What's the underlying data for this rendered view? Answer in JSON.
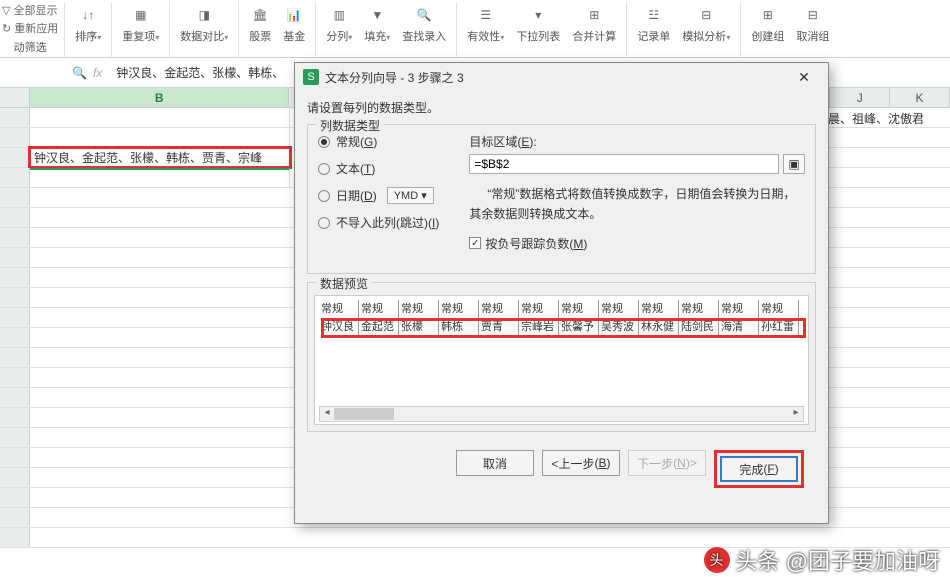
{
  "ribbon": {
    "group1": {
      "show_all": "全部显示",
      "reapply": "重新应用",
      "auto_filter": "动筛选"
    },
    "sort": "排序",
    "dedupe": "重复项",
    "compare": "数据对比",
    "stock": "股票",
    "fund": "基金",
    "split": "分列",
    "fill": "填充",
    "lookup": "查找录入",
    "validity": "有效性",
    "dropdown": "下拉列表",
    "consolidate": "合并计算",
    "record": "记录单",
    "whatif": "模拟分析",
    "group": "创建组",
    "ungroup": "取消组"
  },
  "formula_bar": {
    "text": "钟汉良、金起范、张檬、韩栋、"
  },
  "columns": {
    "B": "B",
    "J": "J",
    "K": "K"
  },
  "cell_text": "钟汉良、金起范、张檬、韩栋、贾青、宗峰",
  "right_cell_text": "晨、祖峰、沈傲君",
  "dialog": {
    "title": "文本分列向导 - 3 步骤之 3",
    "hint": "请设置每列的数据类型。",
    "col_type_legend": "列数据类型",
    "radio_general": "常规",
    "radio_text": "文本",
    "radio_date": "日期",
    "ymd": "YMD",
    "radio_skip": "不导入此列(跳过)",
    "g": "G",
    "t": "T",
    "d": "D",
    "i": "I",
    "target_label": "目标区域",
    "target_key": "E",
    "target_value": "=$B$2",
    "desc": "“常规”数据格式将数值转换成数字，日期值会转换为日期，其余数据则转换成文本。",
    "chk_neg": "按负号跟踪负数",
    "m": "M",
    "preview_legend": "数据预览",
    "preview_head": "常规",
    "preview_cells": [
      "钟汉良",
      "金起范",
      "张檬",
      "韩栋",
      "贾青",
      "宗峰岩",
      "张馨予",
      "吴秀波",
      "林永健",
      "陆剑民",
      "海清",
      "孙红雷"
    ],
    "btn_cancel": "取消",
    "btn_back": "<上一步",
    "btn_back_k": "B",
    "btn_next": "下一步",
    "btn_next_k": "N",
    "btn_finish": "完成",
    "btn_finish_k": "F"
  },
  "watermark": "头条 @团子要加油呀"
}
